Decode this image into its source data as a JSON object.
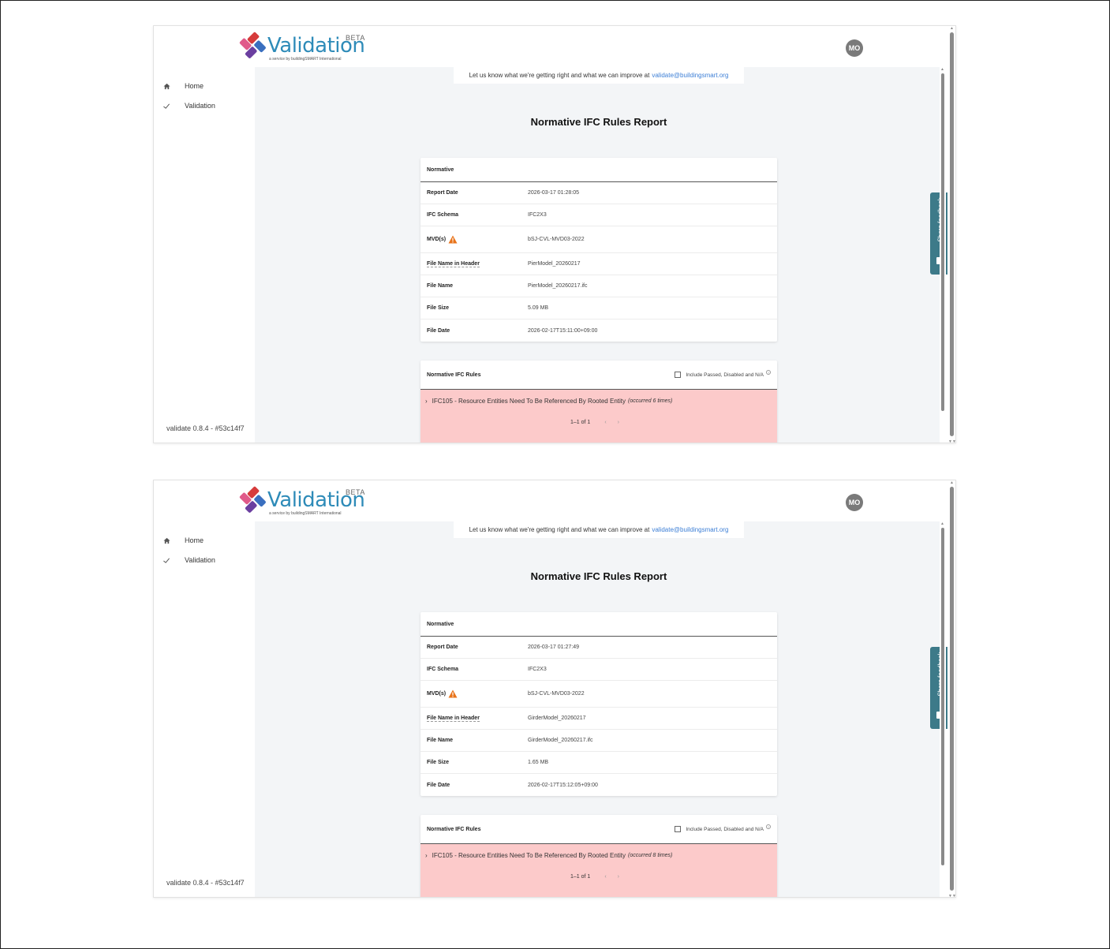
{
  "app": {
    "logo_text": "Validation",
    "logo_sub": "a service by buildingSMART International",
    "beta": "BETA",
    "avatar": "MO",
    "nav": [
      {
        "label": "Home",
        "icon": "home-icon"
      },
      {
        "label": "Validation",
        "icon": "check-icon"
      }
    ],
    "version": "validate 0.8.4 - #53c14f7",
    "feedback_text": "Let us know what we're getting right and what we can improve at",
    "feedback_link": "validate@buildingsmart.org",
    "report_title": "Normative IFC Rules Report",
    "share_feedback": "Share feedback"
  },
  "labels": {
    "card_title": "Normative",
    "report_date": "Report Date",
    "ifc_schema": "IFC Schema",
    "mvds": "MVD(s)",
    "file_name_header": "File Name in Header",
    "file_name": "File Name",
    "file_size": "File Size",
    "file_date": "File Date",
    "rules_title": "Normative IFC Rules",
    "include_label": "Include Passed, Disabled and N/A",
    "help": "?"
  },
  "reports": [
    {
      "report_date": "2026-03-17 01:28:05",
      "ifc_schema": "IFC2X3",
      "mvd": "bSJ-CVL-MVD03-2022",
      "file_name_header": "PierModel_20260217",
      "file_name": "PierModel_20260217.ifc",
      "file_size": "5.09 MB",
      "file_date": "2026-02-17T15:11:00+09:00",
      "rule_text": "IFC105 - Resource Entities Need To Be Referenced By Rooted Entity",
      "rule_occ": "(occurred 6 times)",
      "pager": "1–1 of 1"
    },
    {
      "report_date": "2026-03-17 01:27:49",
      "ifc_schema": "IFC2X3",
      "mvd": "bSJ-CVL-MVD03-2022",
      "file_name_header": "GirderModel_20260217",
      "file_name": "GirderModel_20260217.ifc",
      "file_size": "1.65 MB",
      "file_date": "2026-02-17T15:12:05+09:00",
      "rule_text": "IFC105 - Resource Entities Need To Be Referenced By Rooted Entity",
      "rule_occ": "(occurred 8 times)",
      "pager": "1–1 of 1"
    }
  ],
  "colors": {
    "accent": "#2e8bb8",
    "error_row": "#fccaca",
    "share_tab": "#3d7a89",
    "warning": "#e8731a"
  }
}
